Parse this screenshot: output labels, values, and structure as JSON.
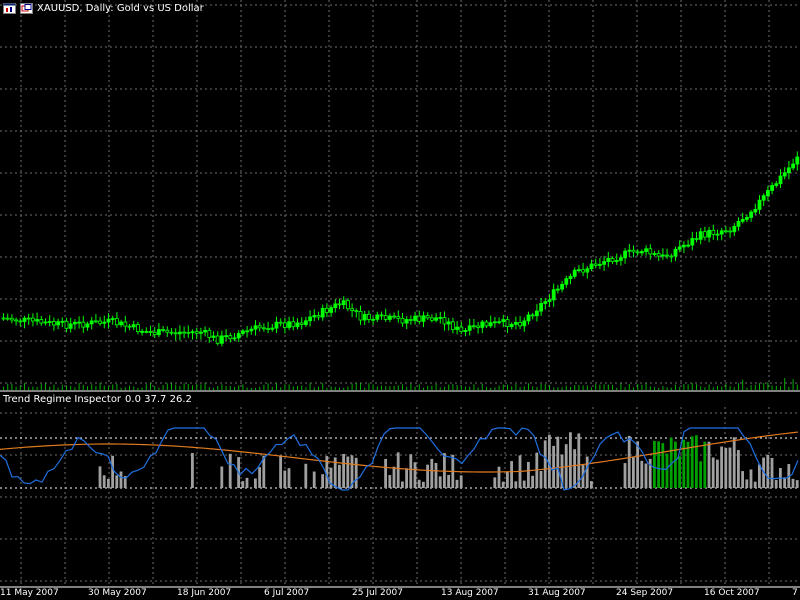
{
  "window": {
    "title": "XAUUSD, Daily:  Gold vs US Dollar"
  },
  "indicator": {
    "name": "Trend Regime Inspector",
    "values": [
      "0.0",
      "37.7",
      "26.2"
    ]
  },
  "time_axis": {
    "labels": [
      "11 May 2007",
      "30 May 2007",
      "18 Jun 2007",
      "6 Jul 2007",
      "25 Jul 2007",
      "13 Aug 2007",
      "31 Aug 2007",
      "24 Sep 2007",
      "16 Oct 2007",
      "7"
    ]
  },
  "colors": {
    "background": "#000000",
    "grid": "#6e6e6e",
    "bull_candle": "#00ff00",
    "bear_candle": "#000000",
    "candle_outline": "#00ff00",
    "volume": "#00b000",
    "blue_line": "#1f6fe0",
    "orange_line": "#e07a1f",
    "histogram_gray": "#a0a0a0",
    "histogram_green": "#00a000"
  },
  "icons": [
    "bar-chart-window-icon",
    "restore-window-icon"
  ]
}
